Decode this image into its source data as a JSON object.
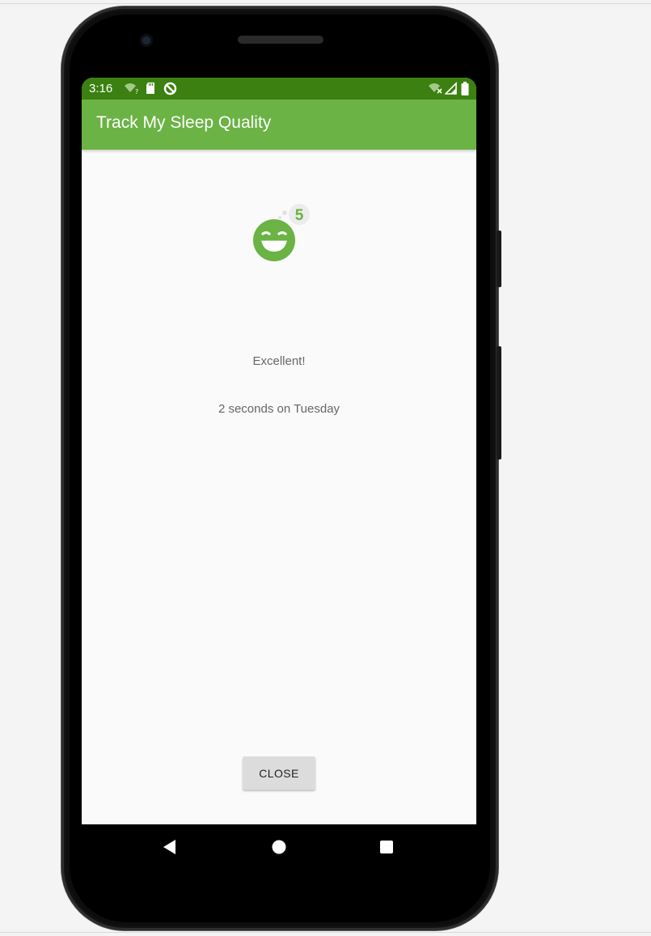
{
  "status_bar": {
    "time": "3:16",
    "icons": [
      "wifi-question-icon",
      "sd-card-icon",
      "sync-disabled-icon",
      "wifi-x-icon",
      "cellular-signal-icon",
      "battery-icon"
    ]
  },
  "app_bar": {
    "title": "Track My Sleep Quality",
    "color": "#6ab344",
    "status_color": "#3b8010"
  },
  "sleep_detail": {
    "quality_icon": "sleep-face-5-icon",
    "quality_badge": "5",
    "quality_text": "Excellent!",
    "length_text": "2 seconds on Tuesday"
  },
  "close_button": {
    "label": "CLOSE"
  },
  "nav_bar": {
    "icons": [
      "back-icon",
      "home-icon",
      "recents-icon"
    ]
  }
}
